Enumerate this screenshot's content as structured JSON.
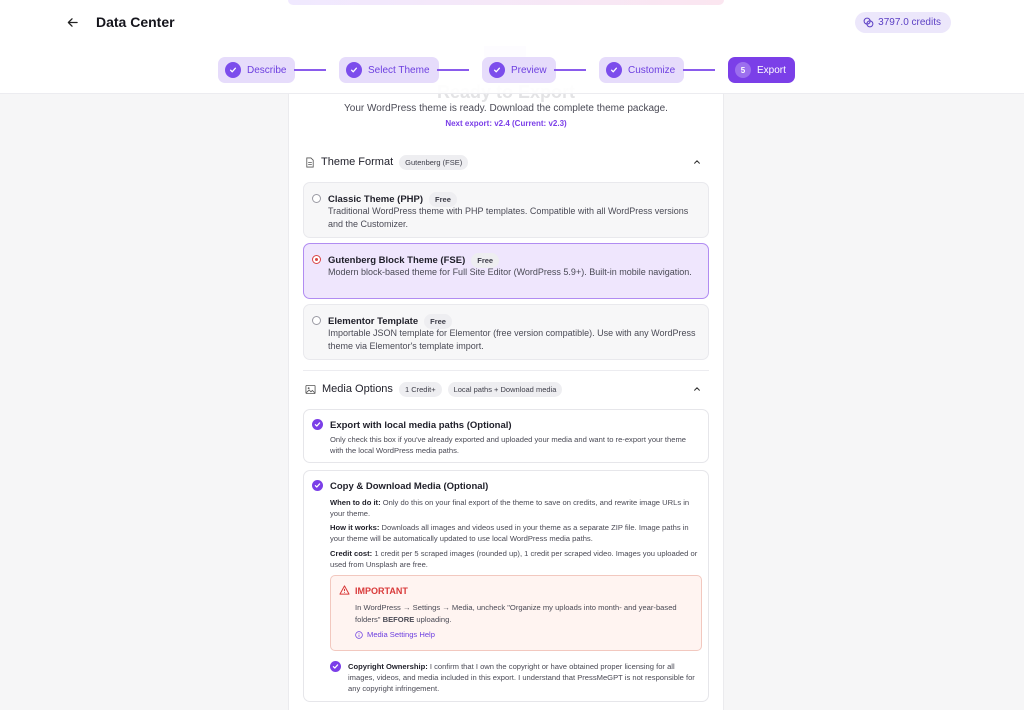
{
  "header": {
    "title": "Data Center",
    "credits": "3797.0 credits"
  },
  "stepper": {
    "steps": [
      {
        "label": "Describe",
        "state": "done"
      },
      {
        "label": "Select Theme",
        "state": "done"
      },
      {
        "label": "Preview",
        "state": "done"
      },
      {
        "label": "Customize",
        "state": "done"
      },
      {
        "number": "5",
        "label": "Export",
        "state": "active"
      }
    ]
  },
  "export": {
    "heading": "Ready to Export",
    "subtitle": "Your WordPress theme is ready. Download the complete theme package.",
    "version_note": "Next export: v2.4 (Current: v2.3)"
  },
  "theme_format": {
    "title": "Theme Format",
    "tag": "Gutenberg (FSE)",
    "options": [
      {
        "title": "Classic Theme (PHP)",
        "badge": "Free",
        "selected": false,
        "description": "Traditional WordPress theme with PHP templates. Compatible with all WordPress versions and the Customizer."
      },
      {
        "title": "Gutenberg Block Theme (FSE)",
        "badge": "Free",
        "selected": true,
        "description": "Modern block-based theme for Full Site Editor (WordPress 5.9+). Built-in mobile navigation."
      },
      {
        "title": "Elementor Template",
        "badge": "Free",
        "selected": false,
        "description": "Importable JSON template for Elementor (free version compatible). Use with any WordPress theme via Elementor's template import."
      }
    ]
  },
  "media_options": {
    "title": "Media Options",
    "tag_credit": "1 Credit+",
    "tag_mode": "Local paths + Download media",
    "local_paths": {
      "title": "Export with local media paths (Optional)",
      "checked": true,
      "description": "Only check this box if you've already exported and uploaded your media and want to re-export your theme with the local WordPress media paths."
    },
    "download": {
      "title": "Copy & Download Media (Optional)",
      "checked": true,
      "when_label": "When to do it:",
      "when_text": " Only do this on your final export of the theme to save on credits, and rewrite image URLs in your theme.",
      "how_label": "How it works:",
      "how_text": " Downloads all images and videos used in your theme as a separate ZIP file. Image paths in your theme will be automatically updated to use local WordPress media paths.",
      "cost_label": "Credit cost:",
      "cost_text": " 1 credit per 5 scraped images (rounded up), 1 credit per scraped video. Images you uploaded or used from Unsplash are free.",
      "important_title": "IMPORTANT",
      "important_text_a": "In WordPress → Settings → Media, uncheck \"Organize my uploads into month- and year-based folders\" ",
      "important_text_bold": "BEFORE",
      "important_text_b": " uploading.",
      "help_link": "Media Settings Help",
      "ownership_label": "Copyright Ownership:",
      "ownership_text": " I confirm that I own the copyright or have obtained proper licensing for all images, videos, and media included in this export. I understand that PressMeGPT is not responsible for any copyright infringement.",
      "ownership_checked": true
    }
  },
  "colors": {
    "accent": "#7b3fe8",
    "accent_light": "#e6dcfb",
    "danger": "#d93a3a"
  }
}
